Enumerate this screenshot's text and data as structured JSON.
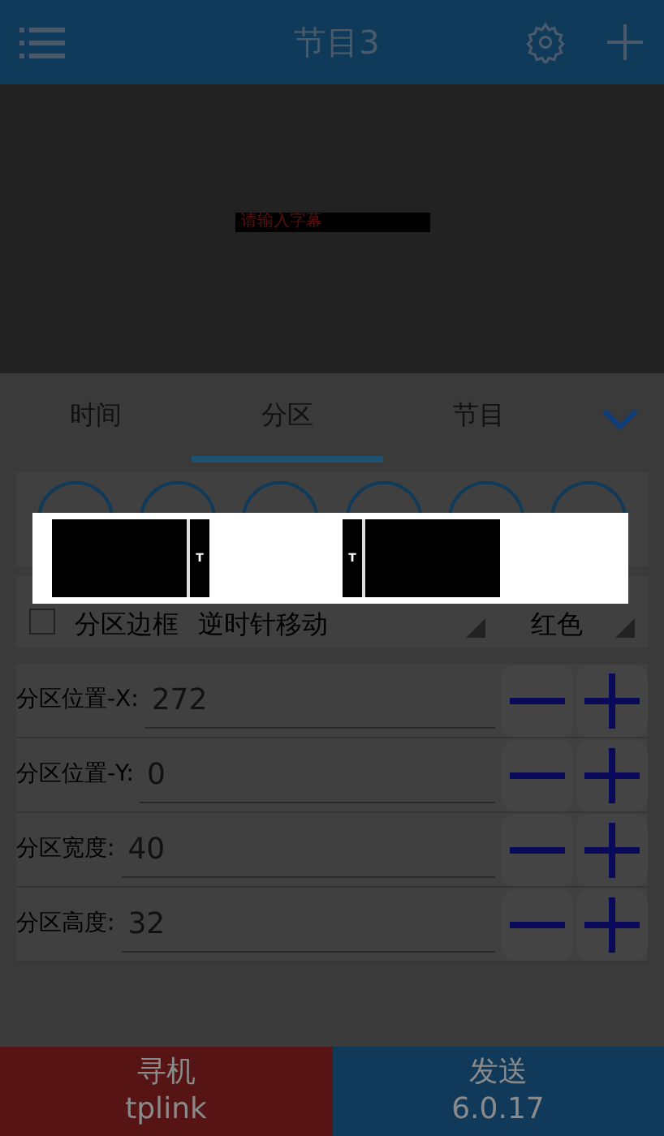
{
  "header": {
    "title": "节目3"
  },
  "preview": {
    "text": "请输入字幕"
  },
  "tabs": [
    {
      "label": "时间",
      "selected": false
    },
    {
      "label": "分区",
      "selected": true
    },
    {
      "label": "节目",
      "selected": false
    }
  ],
  "options": {
    "border": {
      "label": "分区边框",
      "checked": false
    },
    "effect": "逆时针移动",
    "color_name": "红色"
  },
  "fields": [
    {
      "label": "分区位置-X:",
      "value": "272"
    },
    {
      "label": "分区位置-Y:",
      "value": "0"
    },
    {
      "label": "分区宽度:",
      "value": "40"
    },
    {
      "label": "分区高度:",
      "value": "32"
    }
  ],
  "popup": {
    "blocks": [
      {
        "label": "T",
        "kind": "letter_right"
      },
      {
        "label": "T",
        "kind": "letter_left"
      }
    ]
  },
  "footer": [
    {
      "title": "寻机",
      "subtitle": "tplink",
      "color": "#571414"
    },
    {
      "title": "发送",
      "subtitle": "6.0.17",
      "color": "#113a5a"
    }
  ]
}
